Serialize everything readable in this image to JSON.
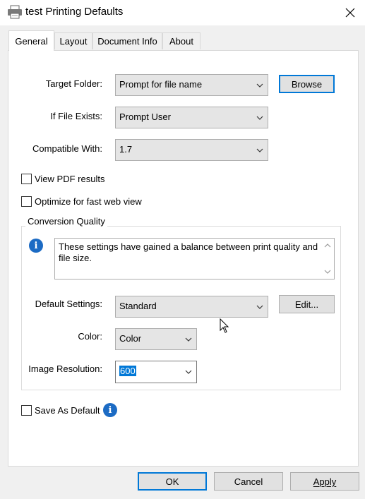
{
  "window": {
    "title": "test Printing Defaults",
    "close_glyph": "✕",
    "icon": "printer-icon"
  },
  "tabs": [
    {
      "label": "General",
      "active": true
    },
    {
      "label": "Layout",
      "active": false
    },
    {
      "label": "Document Info",
      "active": false
    },
    {
      "label": "About",
      "active": false
    }
  ],
  "general": {
    "target_folder": {
      "label": "Target Folder:",
      "value": "Prompt for file name"
    },
    "browse_label": "Browse",
    "if_file_exists": {
      "label": "If File Exists:",
      "value": "Prompt User"
    },
    "compatible_with": {
      "label": "Compatible With:",
      "value": "1.7"
    },
    "view_pdf": {
      "label": "View PDF results",
      "checked": false
    },
    "optimize": {
      "label": "Optimize for fast web view",
      "checked": false
    },
    "conversion_quality": {
      "title": "Conversion Quality",
      "info_text": "These settings have gained a balance between print quality and file size.",
      "default_settings": {
        "label": "Default Settings:",
        "value": "Standard"
      },
      "edit_label": "Edit...",
      "color": {
        "label": "Color:",
        "value": "Color"
      },
      "image_resolution": {
        "label": "Image Resolution:",
        "value": "600"
      }
    },
    "save_as_default": {
      "label": "Save As Default",
      "checked": false
    }
  },
  "footer": {
    "ok_label": "OK",
    "cancel_label": "Cancel",
    "apply_label": "Apply"
  },
  "colors": {
    "accent": "#0078d7",
    "info_icon": "#1c6bc4"
  }
}
